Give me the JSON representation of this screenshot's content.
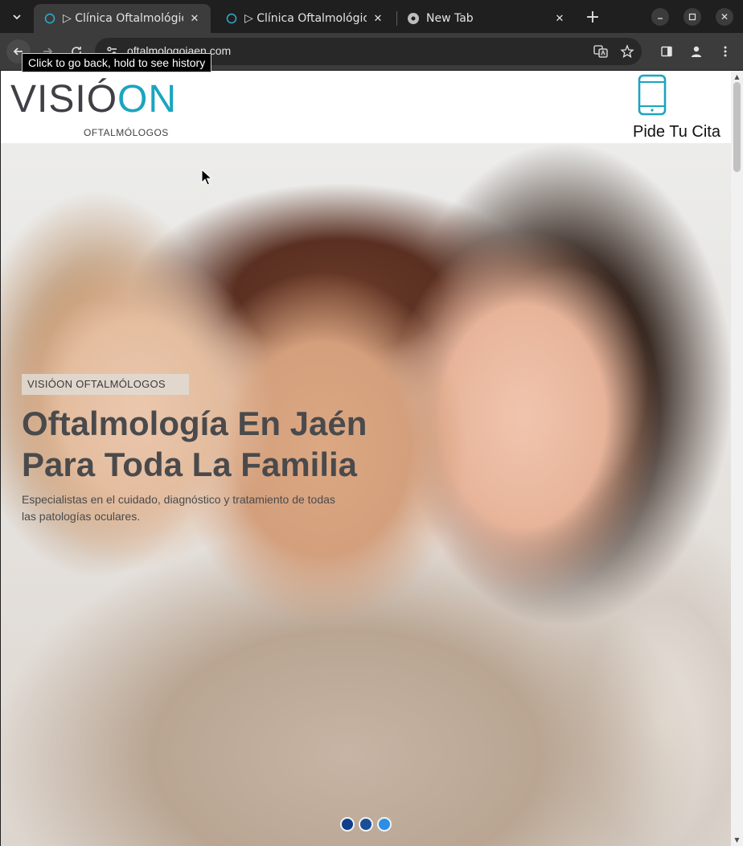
{
  "browser": {
    "tabs": [
      {
        "title": "▷ Clínica Oftalmológica",
        "active": true
      },
      {
        "title": "▷ Clínica Oftalmológica",
        "active": false
      },
      {
        "title": "New Tab",
        "active": false
      }
    ],
    "url": "oftalmologojaen.com",
    "tooltip": "Click to go back, hold to see history"
  },
  "header": {
    "logo_main_prefix": "VISIÓ",
    "logo_main_suffix": "ON",
    "logo_sub": "OFTALMÓLOGOS",
    "cta_label": "Pide Tu Cita"
  },
  "hero": {
    "kicker": "VISIÓON OFTALMÓLOGOS",
    "title": "Oftalmología En Jaén Para Toda La Familia",
    "text": "Especialistas en el cuidado, diagnóstico y tratamiento de todas las patologías oculares.",
    "slides": 3,
    "active_slide": 3
  },
  "colors": {
    "brand_teal": "#1aa5bf",
    "logo_gray": "#3f3f45",
    "dot_active": "#2b8fe8",
    "dot_inactive": "#0d3f8a"
  }
}
